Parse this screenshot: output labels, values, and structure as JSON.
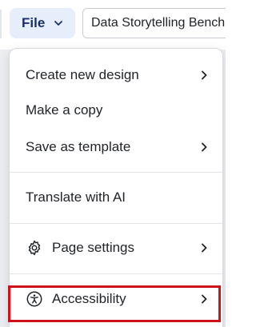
{
  "toolbar": {
    "file_label": "File",
    "title_value": "Data Storytelling Benchmarks"
  },
  "menu": {
    "items": [
      {
        "label": "Create new design",
        "has_submenu": true
      },
      {
        "label": "Make a copy",
        "has_submenu": false
      },
      {
        "label": "Save as template",
        "has_submenu": true
      },
      {
        "label": "Translate with AI",
        "has_submenu": false
      },
      {
        "label": "Page settings",
        "icon": "gear-icon",
        "has_submenu": true
      },
      {
        "label": "Accessibility",
        "icon": "accessibility-icon",
        "has_submenu": true
      }
    ]
  },
  "colors": {
    "file_button_bg": "#e6eefb",
    "file_button_text": "#1b2f6b",
    "highlight": "#d1111a"
  }
}
